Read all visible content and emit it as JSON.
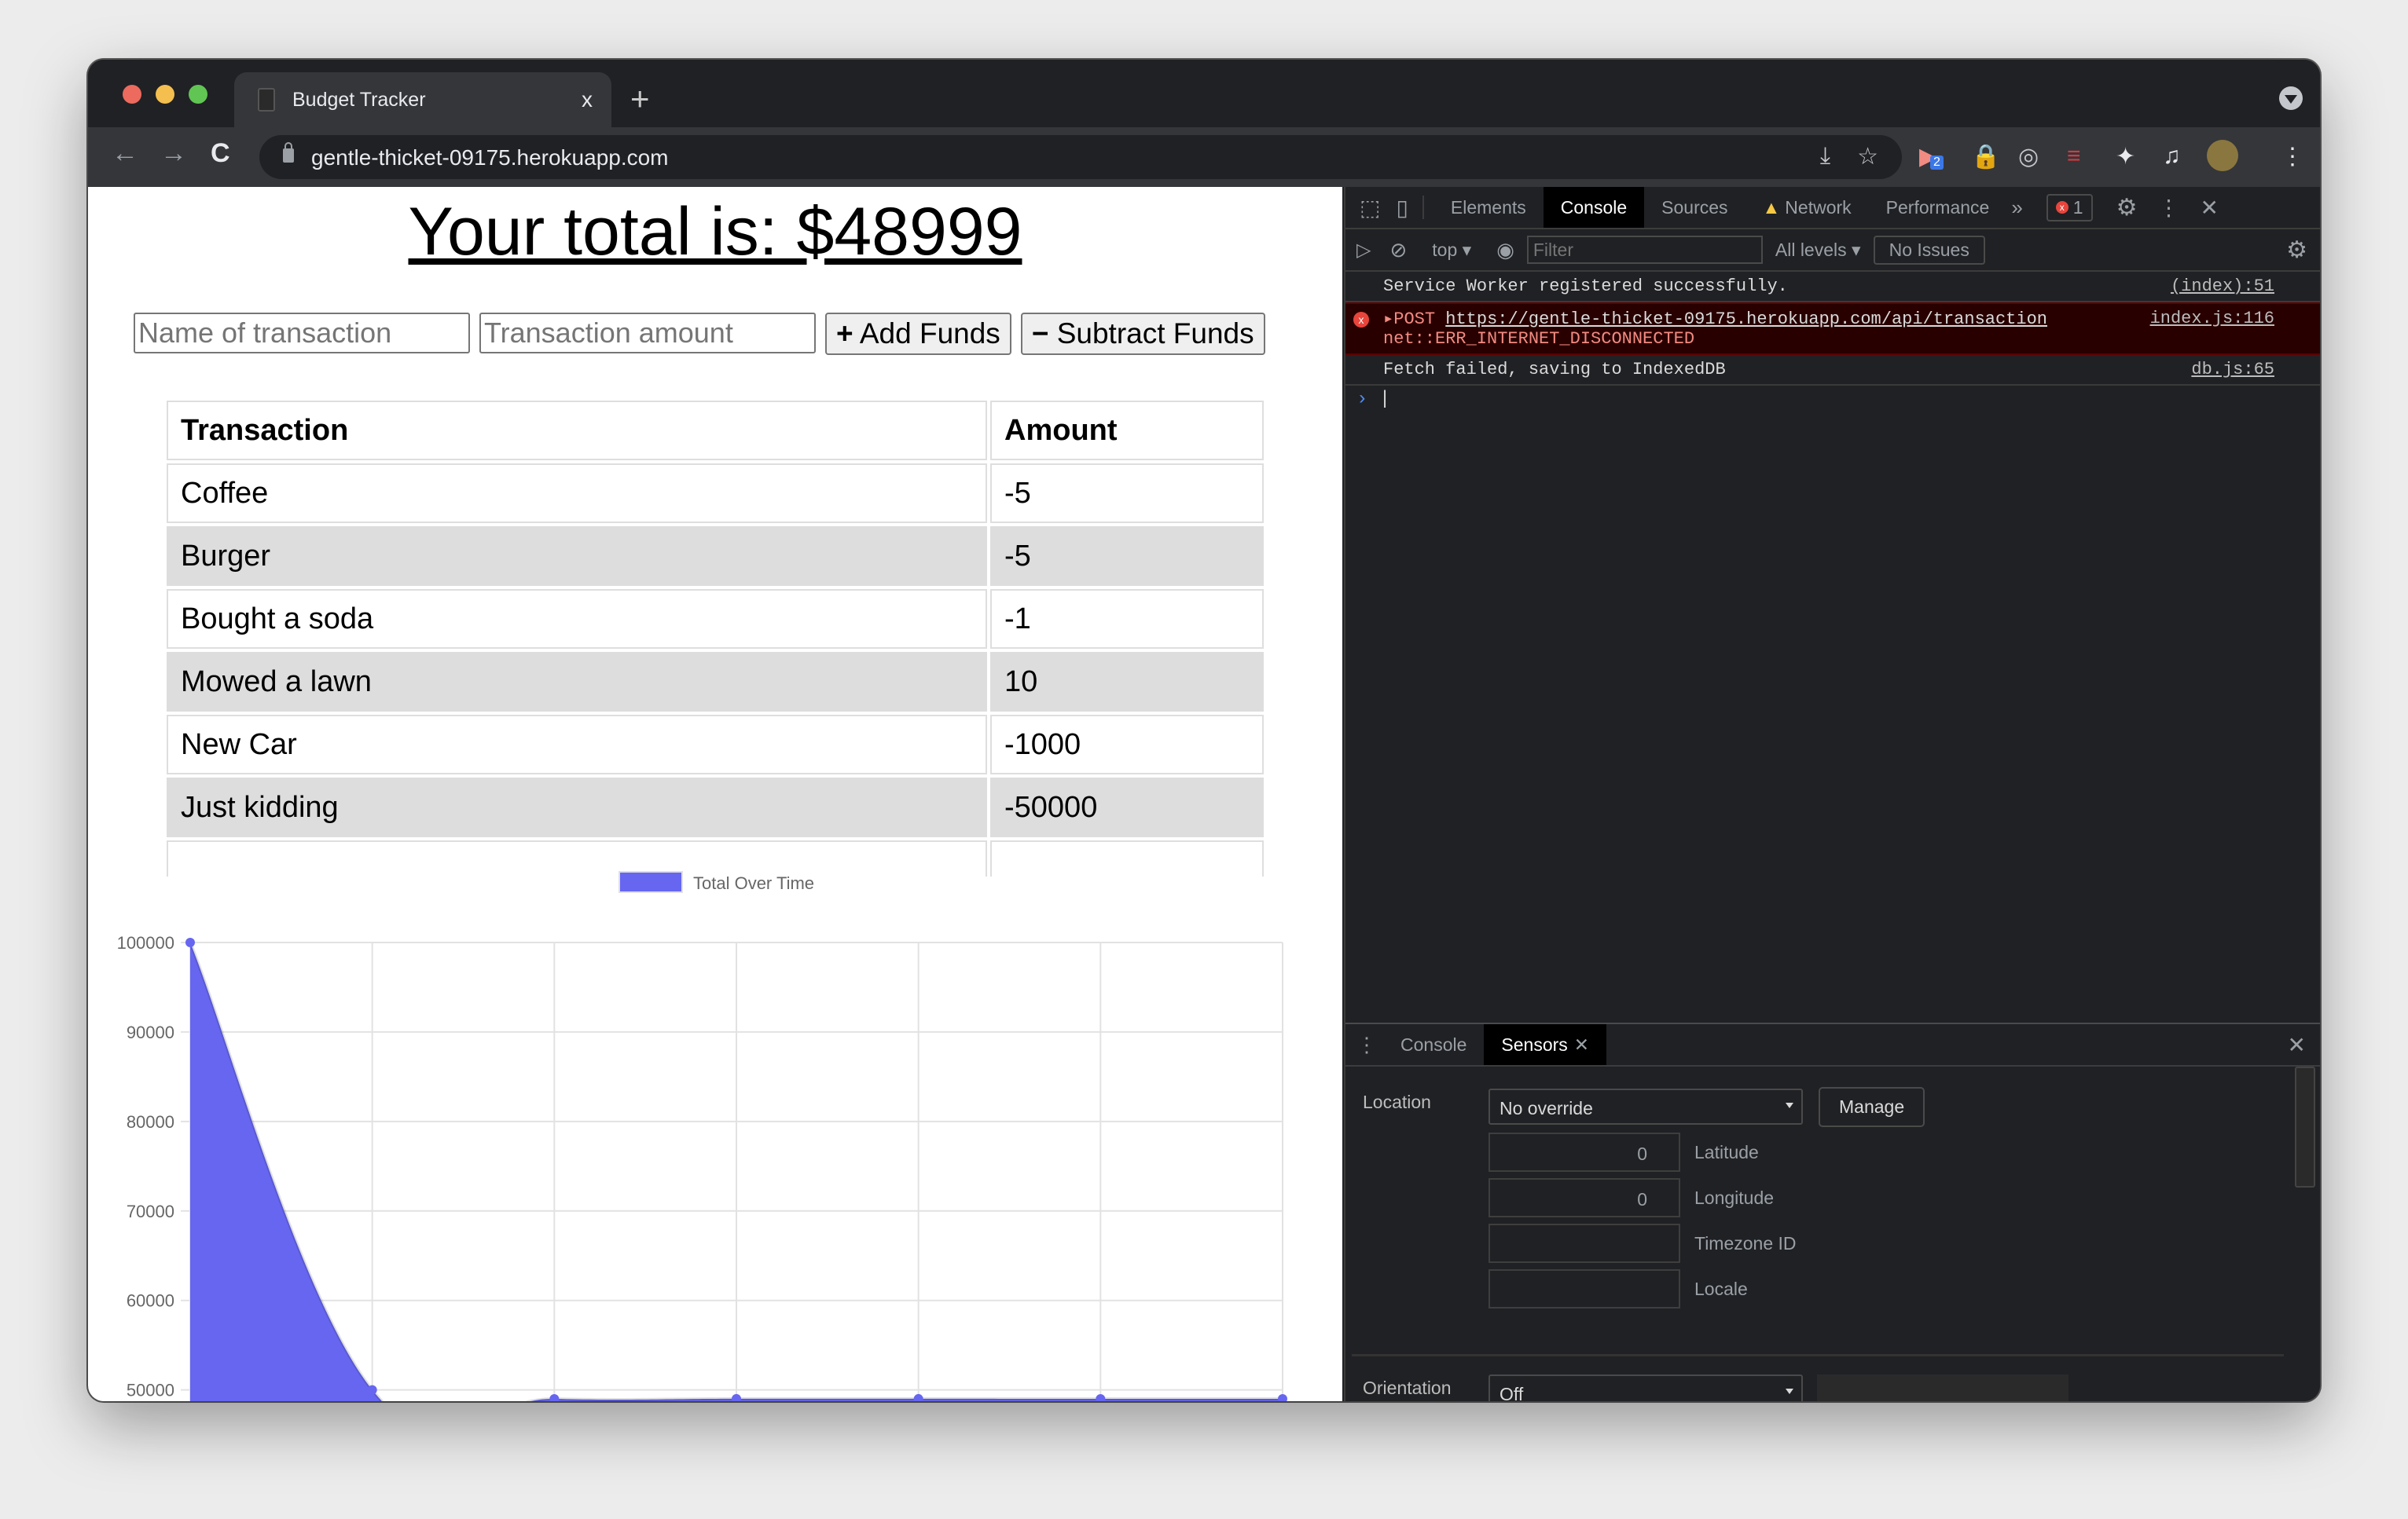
{
  "browser": {
    "tab_title": "Budget Tracker",
    "tab_close": "x",
    "new_tab": "+",
    "url": "gentle-thicket-09175.herokuapp.com",
    "nav": {
      "back": "←",
      "forward": "→",
      "reload": "C"
    },
    "omnibox_icons": [
      "install-icon",
      "star-icon"
    ],
    "extensions": [
      {
        "name": "screencast-extension-icon",
        "badge": "2"
      },
      {
        "name": "padlock-extension-icon"
      },
      {
        "name": "target-extension-icon"
      },
      {
        "name": "expressvpn-extension-icon"
      },
      {
        "name": "puzzle-extensions-icon"
      },
      {
        "name": "media-control-icon"
      },
      {
        "name": "profile-avatar"
      },
      {
        "name": "kebab-menu-icon"
      }
    ]
  },
  "page": {
    "total_heading": "Your total is: $48999",
    "form": {
      "name_placeholder": "Name of transaction",
      "amount_placeholder": "Transaction amount",
      "add_label": "Add Funds",
      "add_icon": "+",
      "subtract_label": "Subtract Funds",
      "subtract_icon": "−"
    },
    "table": {
      "headers": [
        "Transaction",
        "Amount"
      ],
      "rows": [
        {
          "name": "Coffee",
          "amount": "-5"
        },
        {
          "name": "Burger",
          "amount": "-5"
        },
        {
          "name": "Bought a soda",
          "amount": "-1"
        },
        {
          "name": "Mowed a lawn",
          "amount": "10"
        },
        {
          "name": "New Car",
          "amount": "-1000"
        },
        {
          "name": "Just kidding",
          "amount": "-50000"
        }
      ]
    }
  },
  "chart_data": {
    "type": "area",
    "title": "",
    "legend": [
      "Total Over Time"
    ],
    "legend_position": "top",
    "series": [
      {
        "name": "Total Over Time",
        "color": "#6666f1",
        "values": [
          100000,
          50000,
          49000,
          49010,
          49009,
          49004,
          48999
        ]
      }
    ],
    "x": [
      "",
      "",
      "",
      "",
      "",
      "",
      ""
    ],
    "yticks": [
      50000,
      60000,
      70000,
      80000,
      90000,
      100000
    ],
    "ylim": [
      44000,
      100000
    ],
    "grid": true
  },
  "devtools": {
    "tabs": [
      "Elements",
      "Console",
      "Sources",
      "Network",
      "Performance"
    ],
    "active_tab": "Console",
    "more_tabs": "»",
    "error_count": "1",
    "context": "top",
    "filter_placeholder": "Filter",
    "levels": "All levels",
    "issues": "No Issues",
    "messages": [
      {
        "level": "info",
        "text": "Service Worker registered successfully.",
        "source": "(index):51"
      },
      {
        "level": "error",
        "method": "POST",
        "url": "https://gentle-thicket-09175.herokuapp.com/api/transaction",
        "detail": "net::ERR_INTERNET_DISCONNECTED",
        "source": "index.js:116"
      },
      {
        "level": "info",
        "text": "Fetch failed, saving to IndexedDB",
        "source": "db.js:65"
      }
    ],
    "prompt": "›",
    "drawer": {
      "tabs": [
        "Console",
        "Sensors"
      ],
      "active_tab": "Sensors",
      "location_label": "Location",
      "location_value": "No override",
      "manage_label": "Manage",
      "latitude_value": "0",
      "latitude_label": "Latitude",
      "longitude_value": "0",
      "longitude_label": "Longitude",
      "timezone_label": "Timezone ID",
      "locale_label": "Locale",
      "orientation_label": "Orientation",
      "orientation_value": "Off"
    }
  }
}
